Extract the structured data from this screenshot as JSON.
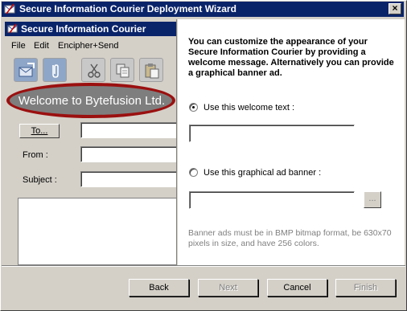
{
  "window": {
    "title": "Secure Information Courier Deployment Wizard",
    "close_glyph": "×"
  },
  "preview": {
    "title": "Secure Information Courier",
    "menu": [
      "File",
      "Edit",
      "Encipher+Send"
    ],
    "toolbar_icons": [
      "envelope-icon",
      "paperclip-icon",
      "scissors-icon",
      "copy-icon",
      "paste-icon"
    ],
    "welcome_banner": "Welcome to Bytefusion Ltd.",
    "to_button": "To...",
    "from_label": "From :",
    "subject_label": "Subject :"
  },
  "content": {
    "intro": "You can customize the appearance of your Secure Information Courier by providing a welcome message. Alternatively you can provide a graphical banner ad.",
    "option_text_label": "Use this welcome text  :",
    "option_banner_label": "Use this graphical ad banner :",
    "welcome_text_value": "",
    "banner_path_value": "",
    "browse_label": "...",
    "hint": "Banner ads must be in BMP bitmap format, be 630x70 pixels in size, and have 256 colors.",
    "selected_option": "welcome-text"
  },
  "buttons": {
    "back": "Back",
    "next": "Next",
    "cancel": "Cancel",
    "finish": "Finish"
  },
  "colors": {
    "titlebar": "#0a246a",
    "oval_border": "#9b1010",
    "face": "#d4d0c8"
  }
}
